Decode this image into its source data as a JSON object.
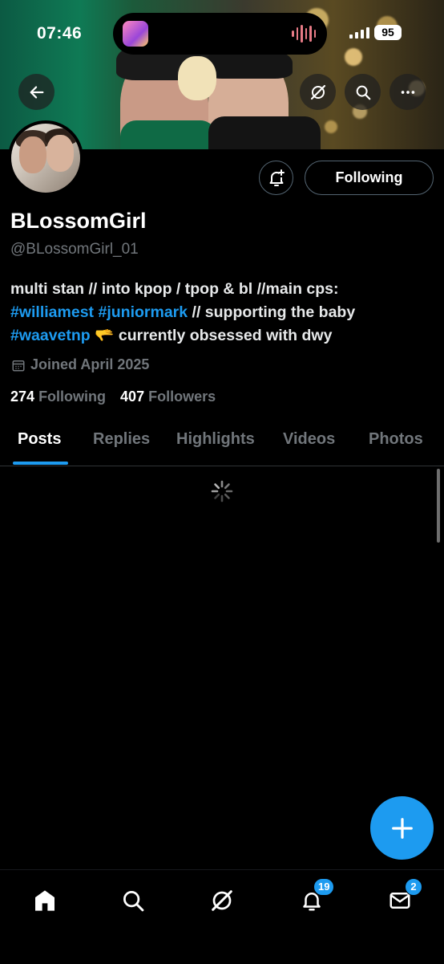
{
  "status_bar": {
    "time": "07:46",
    "battery": "95"
  },
  "header": {
    "back_icon": "arrow-left-icon",
    "grok_icon": "grok-icon",
    "search_icon": "search-icon",
    "more_icon": "more-horizontal-icon"
  },
  "profile": {
    "display_name": "BLossomGirl",
    "handle": "@BLossomGirl_01",
    "bio_parts": {
      "line1": "multi stan // into kpop / tpop & bl //main cps:",
      "tag1": "#williamest",
      "tag2": "#juniormark",
      "mid": " // supporting the baby",
      "tag3": "#waavetnp",
      "emoji": " 🫳 ",
      "end": "currently obsessed with dwy"
    },
    "joined": "Joined April 2025",
    "following_count": "274",
    "following_label": "Following",
    "followers_count": "407",
    "followers_label": "Followers",
    "follow_button_label": "Following"
  },
  "tabs": [
    {
      "label": "Posts",
      "active": true
    },
    {
      "label": "Replies",
      "active": false
    },
    {
      "label": "Highlights",
      "active": false
    },
    {
      "label": "Videos",
      "active": false
    },
    {
      "label": "Photos",
      "active": false
    }
  ],
  "bottom_nav": {
    "home_icon": "home-icon",
    "search_icon": "search-icon",
    "grok_icon": "grok-icon",
    "notifications_icon": "bell-icon",
    "notifications_badge": "19",
    "messages_icon": "mail-icon",
    "messages_badge": "2"
  },
  "colors": {
    "accent": "#1d9bf0",
    "background": "#000000",
    "muted_text": "#71767b"
  }
}
